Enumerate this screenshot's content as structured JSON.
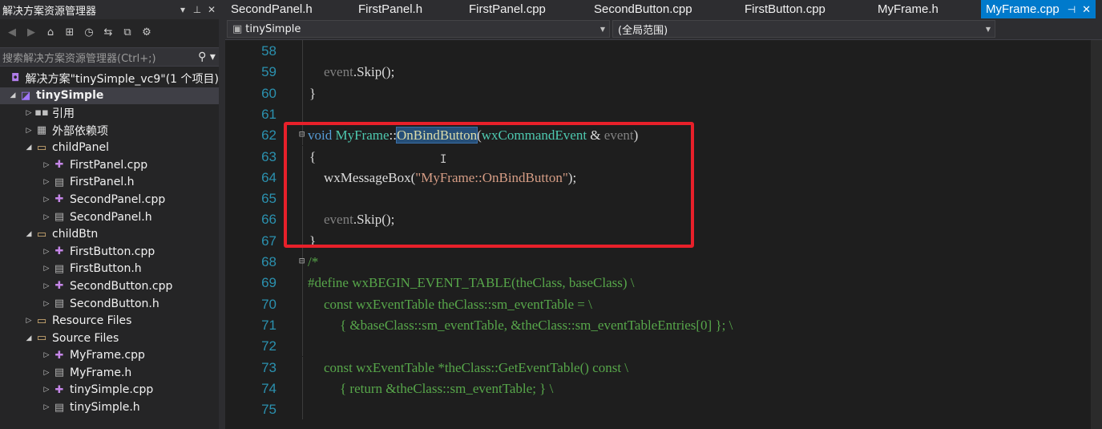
{
  "solution_explorer": {
    "title": "解决方案资源管理器",
    "search_placeholder": "搜索解决方案资源管理器(Ctrl+;)",
    "tree": [
      {
        "label": "解决方案\"tinySimple_vc9\"(1 个项目)",
        "icon": "solution-icon",
        "depth": 0,
        "arrow": "",
        "bold": false,
        "selected": false
      },
      {
        "label": "tinySimple",
        "icon": "project-icon",
        "depth": 0,
        "arrow": "◢",
        "bold": true,
        "selected": true
      },
      {
        "label": "引用",
        "icon": "references-icon",
        "depth": 1,
        "arrow": "▷",
        "bold": false,
        "selected": false
      },
      {
        "label": "外部依赖项",
        "icon": "external-deps-icon",
        "depth": 1,
        "arrow": "▷",
        "bold": false,
        "selected": false
      },
      {
        "label": "childPanel",
        "icon": "folder-icon",
        "depth": 1,
        "arrow": "◢",
        "bold": false,
        "selected": false
      },
      {
        "label": "FirstPanel.cpp",
        "icon": "cpp-file-icon",
        "depth": 2,
        "arrow": "▷",
        "bold": false,
        "selected": false
      },
      {
        "label": "FirstPanel.h",
        "icon": "header-file-icon",
        "depth": 2,
        "arrow": "▷",
        "bold": false,
        "selected": false
      },
      {
        "label": "SecondPanel.cpp",
        "icon": "cpp-file-icon",
        "depth": 2,
        "arrow": "▷",
        "bold": false,
        "selected": false
      },
      {
        "label": "SecondPanel.h",
        "icon": "header-file-icon",
        "depth": 2,
        "arrow": "▷",
        "bold": false,
        "selected": false
      },
      {
        "label": "childBtn",
        "icon": "folder-icon",
        "depth": 1,
        "arrow": "◢",
        "bold": false,
        "selected": false
      },
      {
        "label": "FirstButton.cpp",
        "icon": "cpp-file-icon",
        "depth": 2,
        "arrow": "▷",
        "bold": false,
        "selected": false
      },
      {
        "label": "FirstButton.h",
        "icon": "header-file-icon",
        "depth": 2,
        "arrow": "▷",
        "bold": false,
        "selected": false
      },
      {
        "label": "SecondButton.cpp",
        "icon": "cpp-file-icon",
        "depth": 2,
        "arrow": "▷",
        "bold": false,
        "selected": false
      },
      {
        "label": "SecondButton.h",
        "icon": "header-file-icon",
        "depth": 2,
        "arrow": "▷",
        "bold": false,
        "selected": false
      },
      {
        "label": "Resource Files",
        "icon": "folder-icon",
        "depth": 1,
        "arrow": "▷",
        "bold": false,
        "selected": false
      },
      {
        "label": "Source Files",
        "icon": "folder-icon",
        "depth": 1,
        "arrow": "◢",
        "bold": false,
        "selected": false
      },
      {
        "label": "MyFrame.cpp",
        "icon": "cpp-file-icon",
        "depth": 2,
        "arrow": "▷",
        "bold": false,
        "selected": false
      },
      {
        "label": "MyFrame.h",
        "icon": "header-file-icon",
        "depth": 2,
        "arrow": "▷",
        "bold": false,
        "selected": false
      },
      {
        "label": "tinySimple.cpp",
        "icon": "cpp-file-icon",
        "depth": 2,
        "arrow": "▷",
        "bold": false,
        "selected": false
      },
      {
        "label": "tinySimple.h",
        "icon": "header-file-icon",
        "depth": 2,
        "arrow": "▷",
        "bold": false,
        "selected": false
      }
    ]
  },
  "tabs": [
    {
      "label": "SecondPanel.h",
      "active": false
    },
    {
      "label": "FirstPanel.h",
      "active": false
    },
    {
      "label": "FirstPanel.cpp",
      "active": false
    },
    {
      "label": "SecondButton.cpp",
      "active": false
    },
    {
      "label": "FirstButton.cpp",
      "active": false
    },
    {
      "label": "MyFrame.h",
      "active": false
    },
    {
      "label": "MyFrame.cpp",
      "active": true
    }
  ],
  "navbar": {
    "project": "tinySimple",
    "scope": "(全局范围)"
  },
  "code_lines": [
    {
      "num": "58",
      "fold": "",
      "tokens": []
    },
    {
      "num": "59",
      "fold": "",
      "tokens": [
        {
          "t": "event",
          "c": "param"
        },
        {
          "t": ".Skip();",
          "c": "plain"
        }
      ]
    },
    {
      "num": "60",
      "fold": "",
      "tokens": [
        {
          "t": "}",
          "c": "plain"
        }
      ]
    },
    {
      "num": "61",
      "fold": "",
      "tokens": []
    },
    {
      "num": "62",
      "fold": "⊟",
      "tokens": [
        {
          "t": "void ",
          "c": "kw"
        },
        {
          "t": "MyFrame",
          "c": "type"
        },
        {
          "t": "::",
          "c": "plain"
        },
        {
          "t": "OnBindButton",
          "c": "sel"
        },
        {
          "t": "(",
          "c": "plain"
        },
        {
          "t": "wxCommandEvent",
          "c": "type"
        },
        {
          "t": " & ",
          "c": "plain"
        },
        {
          "t": "event",
          "c": "param"
        },
        {
          "t": ")",
          "c": "plain"
        }
      ]
    },
    {
      "num": "63",
      "fold": "",
      "tokens": [
        {
          "t": "{",
          "c": "plain"
        }
      ]
    },
    {
      "num": "64",
      "fold": "",
      "tokens": [
        {
          "t": "wxMessageBox",
          "c": "plain"
        },
        {
          "t": "(",
          "c": "plain"
        },
        {
          "t": "\"MyFrame::OnBindButton\"",
          "c": "str"
        },
        {
          "t": ");",
          "c": "plain"
        }
      ]
    },
    {
      "num": "65",
      "fold": "",
      "tokens": []
    },
    {
      "num": "66",
      "fold": "",
      "tokens": [
        {
          "t": "event",
          "c": "param"
        },
        {
          "t": ".Skip();",
          "c": "plain"
        }
      ]
    },
    {
      "num": "67",
      "fold": "",
      "tokens": [
        {
          "t": "}",
          "c": "plain"
        }
      ]
    },
    {
      "num": "68",
      "fold": "⊟",
      "tokens": [
        {
          "t": "/*",
          "c": "cmt"
        }
      ]
    },
    {
      "num": "69",
      "fold": "",
      "tokens": [
        {
          "t": "#define wxBEGIN_EVENT_TABLE(theClass, baseClass) \\",
          "c": "cmt"
        }
      ]
    },
    {
      "num": "70",
      "fold": "",
      "tokens": [
        {
          "t": "const wxEventTable theClass::sm_eventTable = \\",
          "c": "cmt"
        }
      ]
    },
    {
      "num": "71",
      "fold": "",
      "tokens": [
        {
          "t": "{ &baseClass::sm_eventTable, &theClass::sm_eventTableEntries[0] }; \\",
          "c": "cmt"
        }
      ]
    },
    {
      "num": "72",
      "fold": "",
      "tokens": []
    },
    {
      "num": "73",
      "fold": "",
      "tokens": [
        {
          "t": "const wxEventTable *theClass::GetEventTable() const \\",
          "c": "cmt"
        }
      ]
    },
    {
      "num": "74",
      "fold": "",
      "tokens": [
        {
          "t": "{ return &theClass::sm_eventTable; } \\",
          "c": "cmt"
        }
      ]
    },
    {
      "num": "75",
      "fold": "",
      "tokens": []
    }
  ]
}
